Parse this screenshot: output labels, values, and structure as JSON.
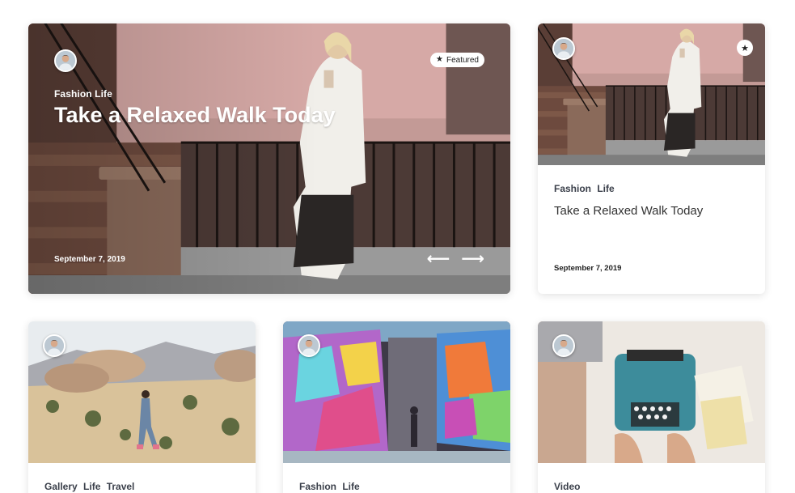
{
  "featured_post": {
    "categories": "Fashion Life",
    "title": "Take a Relaxed Walk Today",
    "date": "September 7, 2019",
    "badge_label": "Featured",
    "badge_icon": "star-icon",
    "prev_arrow": "⟵",
    "next_arrow": "⟶"
  },
  "side_post": {
    "categories": "Fashion  Life",
    "title": "Take a Relaxed Walk Today",
    "date": "September 7, 2019",
    "star_icon": "★"
  },
  "grid_posts": [
    {
      "categories": "Gallery  Life  Travel",
      "image": "desert-photo"
    },
    {
      "categories": "Fashion  Life",
      "image": "stained-glass-photo"
    },
    {
      "categories": "Video",
      "image": "typewriter-photo"
    }
  ],
  "colors": {
    "accent": "#ffffff",
    "text": "#2a2f3a",
    "badge_bg": "#ffffff"
  }
}
